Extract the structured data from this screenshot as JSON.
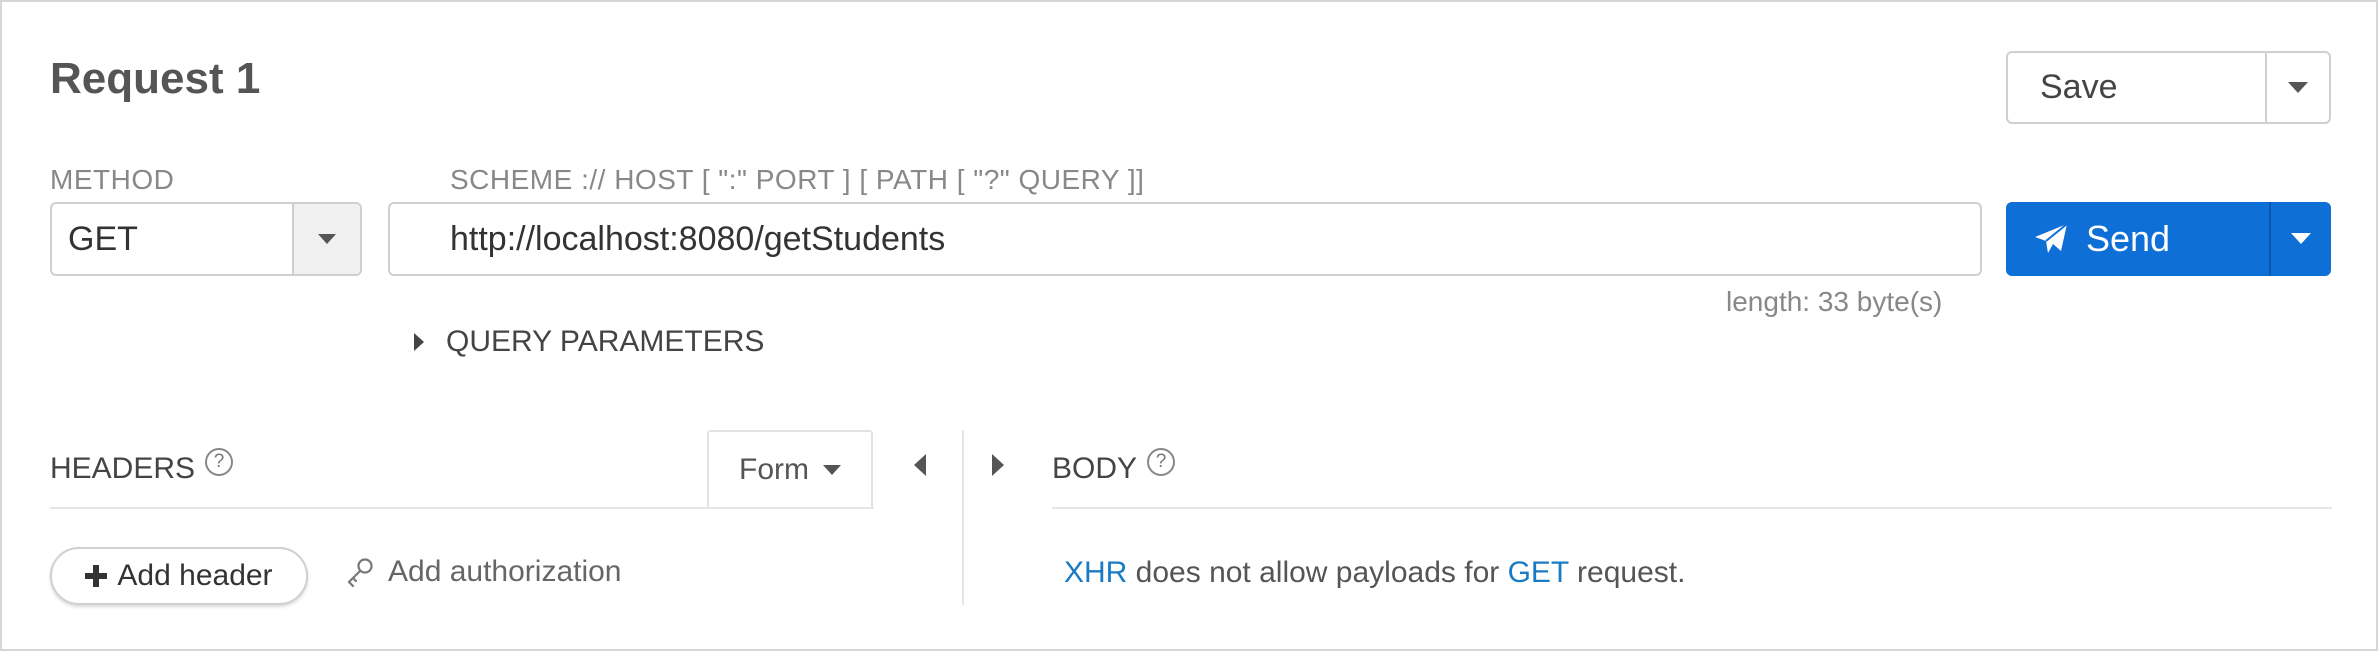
{
  "request": {
    "title": "Request 1"
  },
  "toolbar": {
    "save_label": "Save",
    "send_label": "Send"
  },
  "method": {
    "label": "METHOD",
    "value": "GET"
  },
  "url": {
    "label": "SCHEME :// HOST [ \":\" PORT ] [ PATH [ \"?\" QUERY ]]",
    "value": "http://localhost:8080/getStudents",
    "length_text": "length: 33 byte(s)"
  },
  "query_parameters": {
    "label": "QUERY PARAMETERS"
  },
  "headers": {
    "title": "HEADERS",
    "help_symbol": "?",
    "form_label": "Form",
    "add_header_label": "Add header",
    "add_authorization_label": "Add authorization"
  },
  "body": {
    "title": "BODY",
    "help_symbol": "?",
    "message_xhr": "XHR",
    "message_part1": " does not allow payloads for ",
    "message_get": "GET",
    "message_part2": " request."
  },
  "colors": {
    "accent": "#0e6fd6",
    "link": "#1a7bc4"
  },
  "icons": [
    "chevron-down-icon",
    "paper-plane-icon",
    "caret-right-icon",
    "caret-left-icon",
    "plus-icon",
    "key-icon",
    "help-icon"
  ]
}
